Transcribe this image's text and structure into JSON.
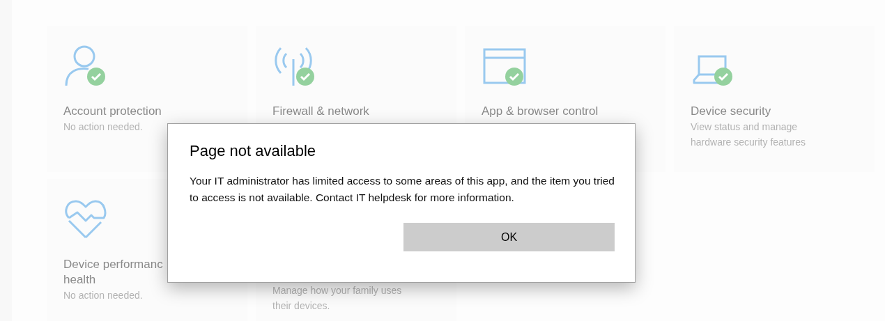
{
  "cards": [
    {
      "kind": "person",
      "badge": true,
      "title": "Account protection",
      "description": "No action needed."
    },
    {
      "kind": "antenna",
      "badge": true,
      "title": "Firewall & network"
    },
    {
      "kind": "browser",
      "badge": true,
      "title": "App & browser control"
    },
    {
      "kind": "laptop",
      "badge": true,
      "title": "Device security",
      "description": "View status and manage\nhardware security features"
    },
    {
      "kind": "heart",
      "badge": false,
      "title": "Device performanc\nhealth",
      "description": "No action needed."
    },
    {
      "description": "Manage how your family uses\ntheir devices."
    }
  ],
  "dialog": {
    "title": "Page not available",
    "message": "Your IT administrator has limited access to some areas of this app, and the item you tried to access is not available. Contact IT helpdesk for more information.",
    "buttons": [
      "OK"
    ]
  }
}
